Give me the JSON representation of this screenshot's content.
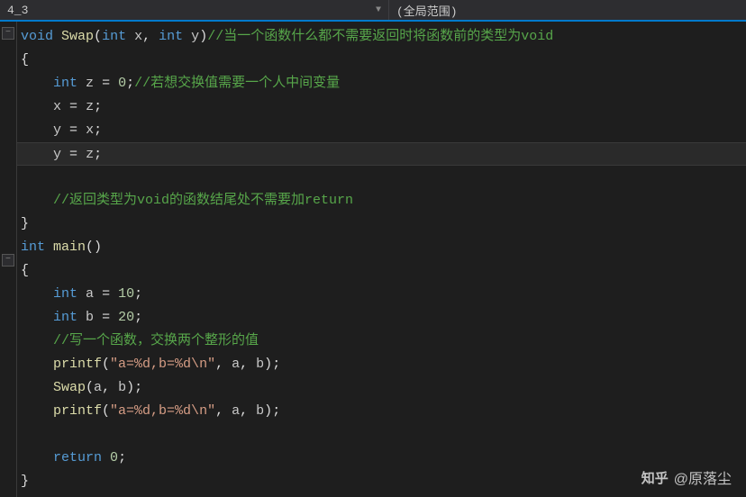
{
  "header": {
    "left_dropdown": "4_3",
    "right_dropdown": "(全局范围)"
  },
  "fold": {
    "minus": "−",
    "minus2": "−"
  },
  "code": {
    "l1": {
      "kw1": "void",
      "fn": "Swap",
      "pn1": "(",
      "kw2": "int",
      "id1": "x",
      "cm": ",",
      "kw3": "int",
      "id2": "y",
      "pn2": ")",
      "comment": "//当一个函数什么都不需要返回时将函数前的类型为void"
    },
    "l2": "{",
    "l3": {
      "kw": "int",
      "id": "z",
      "op": "=",
      "val": "0",
      "sc": ";",
      "comment": "//若想交换值需要一个人中间变量"
    },
    "l4": {
      "id1": "x",
      "op": "=",
      "id2": "z",
      "sc": ";"
    },
    "l5": {
      "id1": "y",
      "op": "=",
      "id2": "x",
      "sc": ";"
    },
    "l6": {
      "id1": "y",
      "op": "=",
      "id2": "z",
      "sc": ";"
    },
    "l8": "//返回类型为void的函数结尾处不需要加return",
    "l9": "}",
    "l10": {
      "kw": "int",
      "fn": "main",
      "pn": "()"
    },
    "l11": "{",
    "l12": {
      "kw": "int",
      "id": "a",
      "op": "=",
      "val": "10",
      "sc": ";"
    },
    "l13": {
      "kw": "int",
      "id": "b",
      "op": "=",
      "val": "20",
      "sc": ";"
    },
    "l14": "//写一个函数，交换两个整形的值",
    "l15": {
      "fn": "printf",
      "pn1": "(",
      "str": "\"a=%d,b=%d\\n\"",
      "cm1": ",",
      "a": "a",
      "cm2": ",",
      "b": "b",
      "pn2": ")",
      "sc": ";"
    },
    "l16": {
      "fn": "Swap",
      "pn1": "(",
      "a": "a",
      "cm": ",",
      "b": "b",
      "pn2": ")",
      "sc": ";"
    },
    "l17": {
      "fn": "printf",
      "pn1": "(",
      "str": "\"a=%d,b=%d\\n\"",
      "cm1": ",",
      "a": "a",
      "cm2": ",",
      "b": "b",
      "pn2": ")",
      "sc": ";"
    },
    "l19": {
      "kw": "return",
      "val": "0",
      "sc": ";"
    },
    "l20": "}"
  },
  "watermark": {
    "site": "知乎",
    "at": "@原落尘"
  }
}
